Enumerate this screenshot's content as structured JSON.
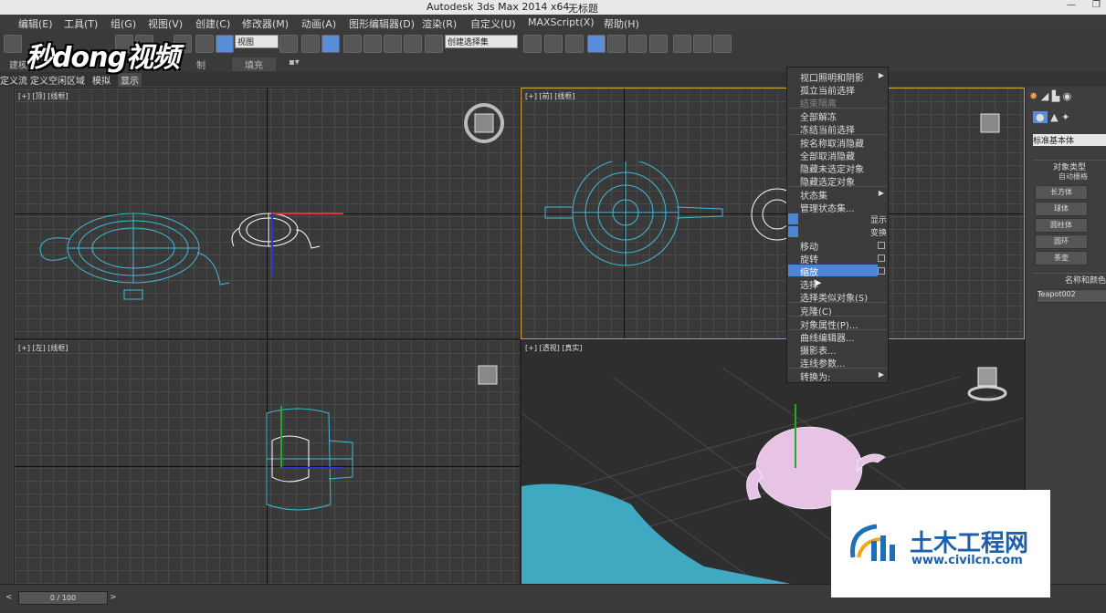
{
  "window": {
    "title": "Autodesk 3ds Max  2014 x64",
    "doc_title": "无标题"
  },
  "menu": [
    "编辑(E)",
    "工具(T)",
    "组(G)",
    "视图(V)",
    "创建(C)",
    "修改器(M)",
    "动画(A)",
    "图形编辑器(D)",
    "渲染(R)",
    "自定义(U)",
    "MAXScript(X)",
    "帮助(H)"
  ],
  "toolbar": {
    "view_dropdown": "视图",
    "selection_set_dropdown": "创建选择集"
  },
  "ribbon": {
    "tab_build": "建模",
    "tab_fill": "填充",
    "tab_other": "制"
  },
  "row2": {
    "items": [
      "定义流",
      "定义空闲区域",
      "模拟",
      "显示"
    ]
  },
  "viewports": [
    {
      "label": "[+] [顶] [线框]"
    },
    {
      "label": "[+] [前] [线框]"
    },
    {
      "label": "[+] [左] [线框]"
    },
    {
      "label": "[+] [透视] [真实]"
    }
  ],
  "context_menu": {
    "items": [
      {
        "label": "视口照明和阴影",
        "submenu": true,
        "disabled": false
      },
      {
        "label": "孤立当前选择",
        "disabled": false
      },
      {
        "label": "结束隔离",
        "disabled": true
      },
      {
        "label": "全部解冻",
        "disabled": false
      },
      {
        "label": "冻结当前选择",
        "disabled": false
      },
      {
        "label": "按名称取消隐藏",
        "disabled": false
      },
      {
        "label": "全部取消隐藏",
        "disabled": false
      },
      {
        "label": "隐藏未选定对象",
        "disabled": false
      },
      {
        "label": "隐藏选定对象",
        "disabled": false
      },
      {
        "label": "状态集",
        "submenu": true,
        "disabled": false
      },
      {
        "label": "管理状态集...",
        "disabled": false
      }
    ],
    "quad_display": "显示",
    "quad_transform": "变换",
    "transform_items": [
      {
        "label": "移动",
        "disabled": false
      },
      {
        "label": "旋转",
        "disabled": false
      },
      {
        "label": "缩放",
        "disabled": false,
        "highlighted": true
      },
      {
        "label": "选择",
        "disabled": false
      },
      {
        "label": "选择类似对象(S)",
        "disabled": false
      },
      {
        "label": "克隆(C)",
        "disabled": false
      },
      {
        "label": "对象属性(P)...",
        "disabled": false
      },
      {
        "label": "曲线编辑器...",
        "disabled": false
      },
      {
        "label": "摄影表...",
        "disabled": false
      },
      {
        "label": "连线参数...",
        "disabled": false
      },
      {
        "label": "转换为:",
        "submenu": true,
        "disabled": false
      }
    ]
  },
  "command_panel": {
    "dropdown": "标准基本体",
    "rollout_object_type": "对象类型",
    "autogrid": "自动栅格",
    "buttons": [
      "长方体",
      "球体",
      "圆柱体",
      "圆环",
      "茶壶"
    ],
    "rollout_name_color": "名称和颜色",
    "object_name": "Teapot002"
  },
  "status": {
    "frame": "0 / 100"
  },
  "logos": {
    "brand_top": "秒dong视频",
    "watermark_cn": "土木工程网",
    "watermark_url": "www.civilcn.com"
  },
  "colors": {
    "wire_blue": "#3fbcd8",
    "selection_white": "#ffffff",
    "highlight": "#4a86d8",
    "active_border": "#c9a23a"
  }
}
